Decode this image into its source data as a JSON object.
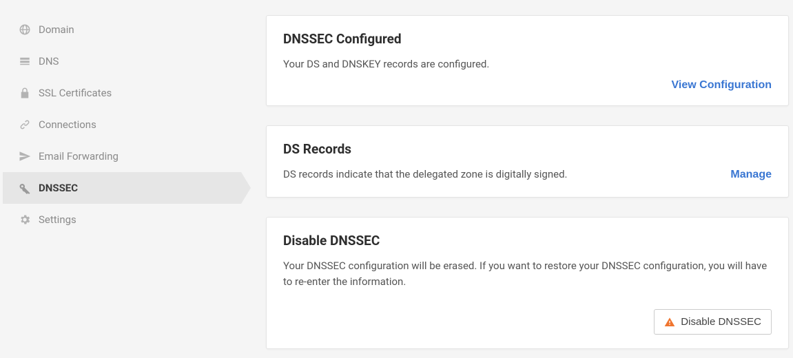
{
  "sidebar": {
    "items": [
      {
        "label": "Domain"
      },
      {
        "label": "DNS"
      },
      {
        "label": "SSL Certificates"
      },
      {
        "label": "Connections"
      },
      {
        "label": "Email Forwarding"
      },
      {
        "label": "DNSSEC"
      },
      {
        "label": "Settings"
      }
    ],
    "active_index": 5
  },
  "cards": {
    "configured": {
      "title": "DNSSEC Configured",
      "text": "Your DS and DNSKEY records are configured.",
      "action": "View Configuration"
    },
    "ds_records": {
      "title": "DS Records",
      "text": "DS records indicate that the delegated zone is digitally signed.",
      "action": "Manage"
    },
    "disable": {
      "title": "Disable DNSSEC",
      "text": "Your DNSSEC configuration will be erased. If you want to restore your DNSSEC configuration, you will have to re-enter the information.",
      "action": "Disable DNSSEC"
    }
  }
}
